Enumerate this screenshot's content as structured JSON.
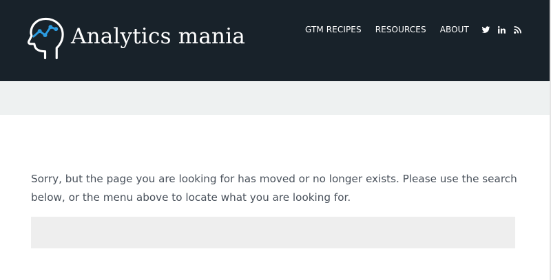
{
  "header": {
    "site_name": "Analytics mania",
    "nav": [
      {
        "label": "GTM RECIPES"
      },
      {
        "label": "RESOURCES"
      },
      {
        "label": "ABOUT"
      }
    ],
    "social": [
      "twitter-icon",
      "linkedin-icon",
      "rss-icon"
    ]
  },
  "content": {
    "message": "Sorry, but the page you are looking for has moved or no longer exists. Please use the search below, or the menu above to locate what you are looking for.",
    "search_value": "",
    "search_placeholder": ""
  },
  "colors": {
    "header_bg": "#18222a",
    "band_bg": "#eef1f1",
    "logo_accent": "#2b9be0",
    "body_text": "#48505a",
    "search_bg": "#eeeeee"
  }
}
